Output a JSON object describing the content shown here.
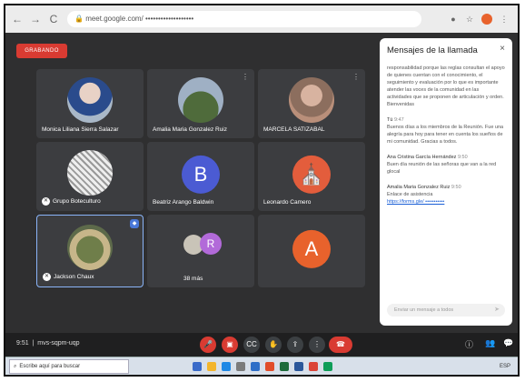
{
  "browser": {
    "url": "meet.google.com/ •••••••••••••••••••",
    "back": "←",
    "forward": "→",
    "reload": "C"
  },
  "record_label": "GRABANDO",
  "participants": [
    {
      "name": "Monica Liliana Sierra Salazar",
      "type": "photo",
      "color": "#a9b8c8"
    },
    {
      "name": "Amalia Maria Gonzalez Ruiz",
      "type": "photo",
      "color": "#6b7b58"
    },
    {
      "name": "MARCELA SATIZABAL",
      "type": "photo",
      "color": "#b98f7a"
    },
    {
      "name": "Grupo Boteculturo",
      "type": "photo",
      "color": "#dcdcdc"
    },
    {
      "name": "Beatriz Arango Baldwin",
      "letter": "B",
      "type": "letter",
      "color": "#4b5bd3"
    },
    {
      "name": "Leonardo Camero",
      "type": "photo",
      "color": "#e35d3c"
    },
    {
      "name": "Jackson Chaux",
      "type": "photo",
      "color": "#5d6a4a"
    },
    {
      "name": "38 más",
      "letter": "R",
      "type": "group",
      "color": "#b26ad9"
    },
    {
      "name": "",
      "letter": "A",
      "type": "letter",
      "color": "#e8622c"
    }
  ],
  "chat": {
    "title": "Mensajes de la llamada",
    "messages": [
      {
        "text": "responsabilidad porque las reglas consultan el apoyo de quienes cuentan con el conocimiento, el seguimiento y evaluación por lo que es importante atender las voces de la comunidad en las actividades que se proponen de articulación y orden. Bienvenidas"
      },
      {
        "who": "Tú",
        "time": "9:47",
        "text": "Buenos días a los miembros de la Reunión. Fue una alegría para hoy para tener en cuenta los sueños de mi comunidad. Gracias a todos."
      },
      {
        "who": "Ana Cristina García Hernández",
        "time": "9:50",
        "text": "Buen día reunión de las señoras que van a la red glocal"
      },
      {
        "who": "Amalia Maria Gonzalez Ruiz",
        "time": "9:50",
        "text": "Enlace de asistencia",
        "link": "https://forms.gle/ •••••••••••"
      }
    ],
    "input_placeholder": "Enviar un mensaje a todos",
    "close": "×"
  },
  "controls": {
    "time": "9:51",
    "meeting_code": "mvs-sqpm-uqp"
  },
  "taskbar": {
    "search_placeholder": "Escribe aquí para buscar",
    "tray": "ESP"
  }
}
